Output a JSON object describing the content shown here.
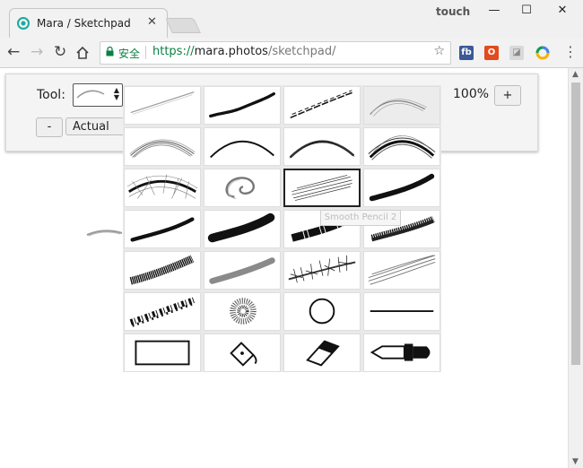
{
  "browser": {
    "tab_title": "Mara / Sketchpad",
    "window_label": "touch",
    "security_label": "安全",
    "url_scheme": "https://",
    "url_host": "mara.photos",
    "url_path": "/sketchpad/"
  },
  "extensions": [
    "facebook-icon",
    "office-icon",
    "image-icon",
    "sync-icon"
  ],
  "toolbar": {
    "tool_label": "Tool:",
    "zoom_value": "100%",
    "zoom_in": "+",
    "zoom_out": "-",
    "actual_pixels": "Actual Pi"
  },
  "palette": {
    "tooltip": "Smooth Pencil 2",
    "tools": [
      "pencil-thin",
      "pencil-dark",
      "pencil-double",
      "soft-arc",
      "arc-sketch",
      "arc-line",
      "arc-thick",
      "arc-hairy",
      "arc-fur",
      "swirl",
      "smooth-pencil-2",
      "marker-black",
      "marker-dotted",
      "marker-thick",
      "crayon",
      "chalk-hatched",
      "chalk",
      "charcoal-grey",
      "thorns",
      "fur-grey",
      "spatter",
      "spray",
      "circle",
      "line",
      "rectangle",
      "fill",
      "eraser",
      "dropper"
    ],
    "selected_index": 10
  }
}
